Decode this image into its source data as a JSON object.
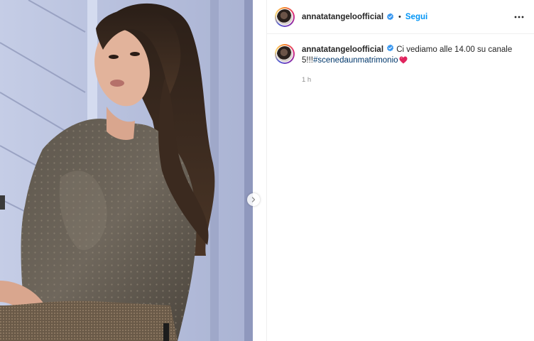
{
  "post": {
    "username": "annatatangeloofficial",
    "follow_label": "Segui",
    "separator": "•",
    "caption_text": "Ci vediamo alle 14.00 su canale 5!!!",
    "hashtag": "#scenedaunmatrimonio",
    "time_ago": "1 h"
  },
  "icons": {
    "verified": "verified-badge-icon",
    "more": "more-options-icon",
    "next": "chevron-right-icon",
    "heart": "red-heart-emoji"
  },
  "colors": {
    "accent": "#0095f6",
    "verified": "#3897f0",
    "hashtag": "#00376b",
    "heart": "#e0245e"
  }
}
